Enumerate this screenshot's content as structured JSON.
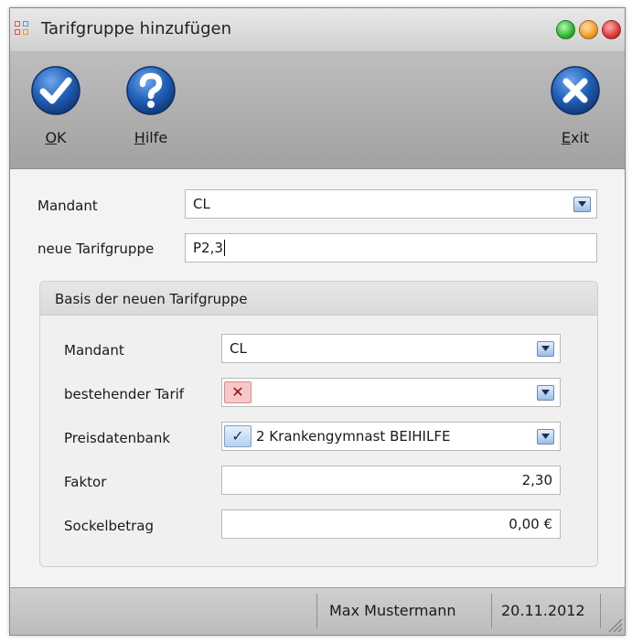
{
  "window": {
    "title": "Tarifgruppe hinzufügen",
    "traffic_lights": [
      "#3cc43c",
      "#f2a33a",
      "#e53b3b"
    ]
  },
  "toolbar": {
    "ok_label": "OK",
    "help_label": "Hilfe",
    "exit_label": "Exit",
    "icon_color": "#1f5fb8"
  },
  "form": {
    "mandant_label": "Mandant",
    "mandant_value": "CL",
    "tarifgruppe_label": "neue Tarifgruppe",
    "tarifgruppe_value": "P2,3"
  },
  "group": {
    "title": "Basis der neuen Tarifgruppe",
    "mandant_label": "Mandant",
    "mandant_value": "CL",
    "tarif_label": "bestehender Tarif",
    "tarif_value": "",
    "tarif_icon": "x-icon",
    "preis_label": "Preisdatenbank",
    "preis_value": "2 Krankengymnast BEIHILFE",
    "preis_icon": "check-icon",
    "faktor_label": "Faktor",
    "faktor_value": "2,30",
    "sockel_label": "Sockelbetrag",
    "sockel_value": "0,00 €"
  },
  "status": {
    "user": "Max Mustermann",
    "date": "20.11.2012"
  }
}
